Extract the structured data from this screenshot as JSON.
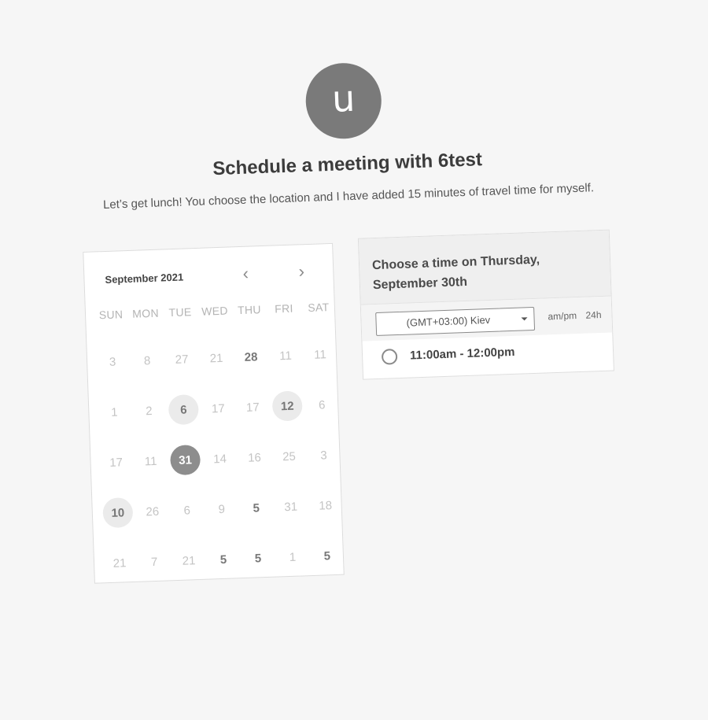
{
  "header": {
    "avatar_letter": "u",
    "title": "Schedule a meeting with 6test",
    "description": "Let’s get lunch! You choose the location and I have added 15 minutes of travel time for myself."
  },
  "calendar": {
    "month_label": "September 2021",
    "prev_icon": "chevron-left-icon",
    "next_icon": "chevron-right-icon",
    "weekdays": [
      "SUN",
      "MON",
      "TUE",
      "WED",
      "THU",
      "FRI",
      "SAT"
    ],
    "weeks": [
      [
        {
          "d": "3",
          "s": "muted"
        },
        {
          "d": "8",
          "s": "muted"
        },
        {
          "d": "27",
          "s": "muted"
        },
        {
          "d": "21",
          "s": "muted"
        },
        {
          "d": "28",
          "s": "available"
        },
        {
          "d": "11",
          "s": "muted"
        },
        {
          "d": "11",
          "s": "muted"
        }
      ],
      [
        {
          "d": "1",
          "s": "muted"
        },
        {
          "d": "2",
          "s": "muted"
        },
        {
          "d": "6",
          "s": "highlighted"
        },
        {
          "d": "17",
          "s": "muted"
        },
        {
          "d": "17",
          "s": "muted"
        },
        {
          "d": "12",
          "s": "highlighted"
        },
        {
          "d": "6",
          "s": "muted"
        }
      ],
      [
        {
          "d": "17",
          "s": "muted"
        },
        {
          "d": "11",
          "s": "muted"
        },
        {
          "d": "31",
          "s": "selected"
        },
        {
          "d": "14",
          "s": "muted"
        },
        {
          "d": "16",
          "s": "muted"
        },
        {
          "d": "25",
          "s": "muted"
        },
        {
          "d": "3",
          "s": "muted"
        }
      ],
      [
        {
          "d": "10",
          "s": "highlighted"
        },
        {
          "d": "26",
          "s": "muted"
        },
        {
          "d": "6",
          "s": "muted"
        },
        {
          "d": "9",
          "s": "muted"
        },
        {
          "d": "5",
          "s": "available"
        },
        {
          "d": "31",
          "s": "muted"
        },
        {
          "d": "18",
          "s": "muted"
        }
      ],
      [
        {
          "d": "21",
          "s": "muted"
        },
        {
          "d": "7",
          "s": "muted"
        },
        {
          "d": "21",
          "s": "muted"
        },
        {
          "d": "5",
          "s": "available"
        },
        {
          "d": "5",
          "s": "available"
        },
        {
          "d": "1",
          "s": "muted"
        },
        {
          "d": "5",
          "s": "available"
        }
      ]
    ]
  },
  "time_panel": {
    "heading_line1": "Choose a time on Thursday,",
    "heading_line2": "September 30th",
    "timezone": "(GMT+03:00) Kiev",
    "format_ampm": "am/pm",
    "format_24h": "24h",
    "slots": [
      {
        "label": "11:00am - 12:00pm",
        "selected": false
      }
    ]
  }
}
